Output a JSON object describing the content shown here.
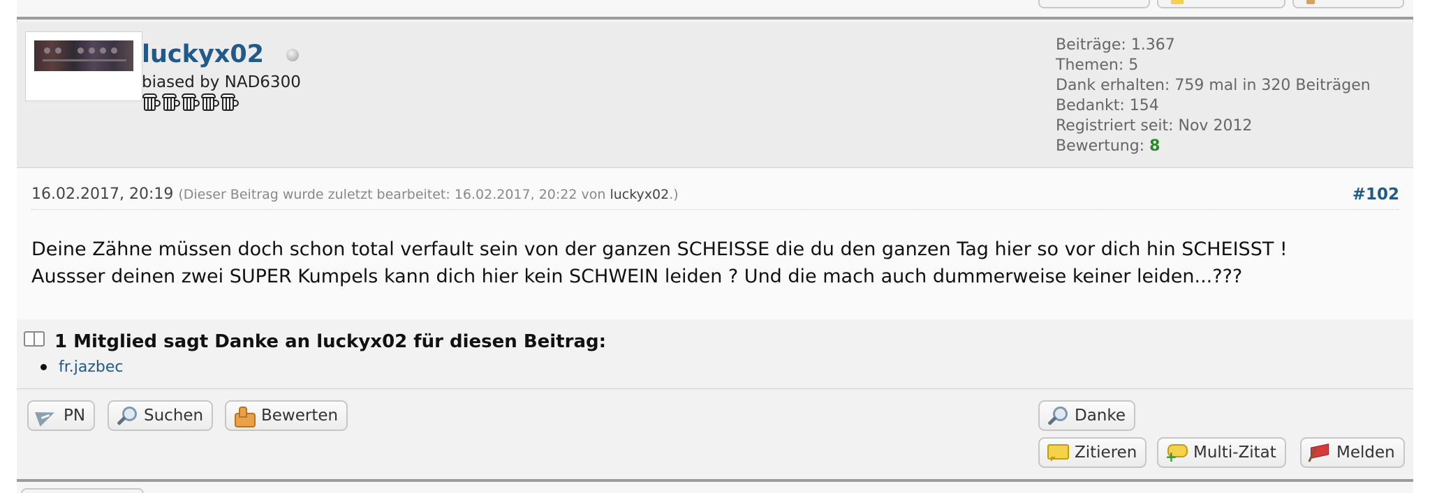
{
  "user": {
    "name": "luckyx02",
    "title": "biased by NAD6300",
    "rank_icons": [
      "beer-mug-icon",
      "beer-mug-icon",
      "beer-mug-icon",
      "beer-mug-icon",
      "beer-mug-icon"
    ],
    "online_status": "offline"
  },
  "stats": [
    {
      "label": "Beiträge:",
      "value": "1.367"
    },
    {
      "label": "Themen:",
      "value": "5"
    },
    {
      "label": "Dank erhalten:",
      "value": "759 mal in 320 Beiträgen"
    },
    {
      "label": "Bedankt:",
      "value": "154"
    },
    {
      "label": "Registriert seit:",
      "value": "Nov 2012"
    }
  ],
  "rating": {
    "label": "Bewertung:",
    "value": "8",
    "color": "#2a8a2a"
  },
  "post": {
    "date": "16.02.2017, 20:19",
    "edit_prefix": "(Dieser Beitrag wurde zuletzt bearbeitet: 16.02.2017, 20:22 von",
    "edit_user": "luckyx02",
    "edit_suffix": ".)",
    "number": "#102",
    "body_line1": "Deine Zähne müssen doch schon total verfault sein von der ganzen SCHEISSE die du den ganzen Tag hier so vor dich hin SCHEISST !",
    "body_line2": "Aussser deinen zwei SUPER Kumpels kann dich hier kein SCHWEIN leiden ? Und die mach auch dummerweise keiner leiden...???"
  },
  "thanks": {
    "title": "1 Mitglied sagt Danke an luckyx02 für diesen Beitrag:",
    "users": [
      "fr.jazbec"
    ]
  },
  "buttons": {
    "pn": "PN",
    "search": "Suchen",
    "rate": "Bewerten",
    "thank": "Danke",
    "quote": "Zitieren",
    "multiquote": "Multi-Zitat",
    "report": "Melden"
  },
  "colors": {
    "link": "#1f5a8a",
    "rating": "#2a8a2a",
    "divider": "#9c9c9c"
  }
}
